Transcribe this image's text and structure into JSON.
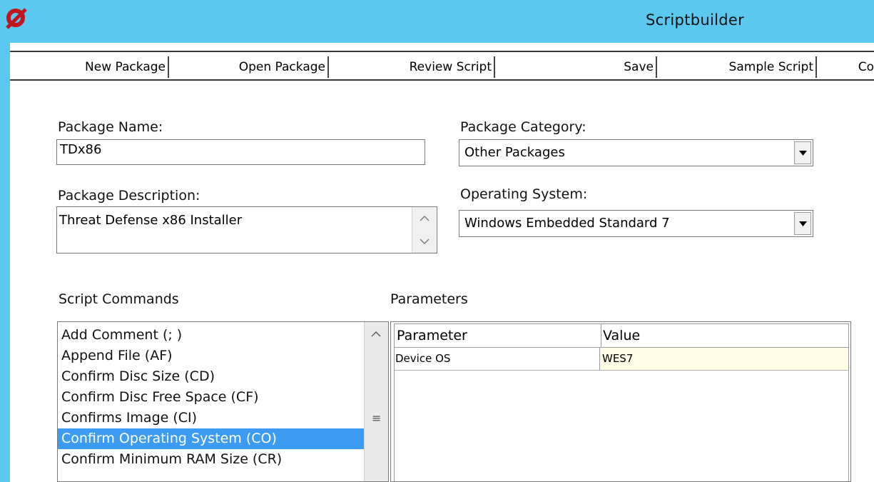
{
  "window": {
    "title": "Scriptbuilder",
    "accent_color": "#5bc8ef",
    "logo_icon": "app-logo-icon"
  },
  "toolbar": {
    "new_package": "New Package",
    "open_package": "Open Package",
    "review_script": "Review Script",
    "save": "Save",
    "sample_script": "Sample Script",
    "truncated": "Co"
  },
  "form": {
    "package_name_label": "Package Name:",
    "package_name_value": "TDx86",
    "package_description_label": "Package Description:",
    "package_description_value": "Threat Defense x86 Installer",
    "package_category_label": "Package Category:",
    "package_category_value": "Other Packages",
    "operating_system_label": "Operating System:",
    "operating_system_value": "Windows Embedded Standard 7"
  },
  "script_commands": {
    "label": "Script Commands",
    "selected_color": "#3d9bf1",
    "items": [
      {
        "label": "Add Comment (; )",
        "selected": false
      },
      {
        "label": "Append File (AF)",
        "selected": false
      },
      {
        "label": "Confirm Disc Size (CD)",
        "selected": false
      },
      {
        "label": "Confirm Disc Free Space (CF)",
        "selected": false
      },
      {
        "label": "Confirms Image (CI)",
        "selected": false
      },
      {
        "label": "Confirm Operating System (CO)",
        "selected": true
      },
      {
        "label": "Confirm Minimum RAM Size (CR)",
        "selected": false
      }
    ]
  },
  "parameters": {
    "label": "Parameters",
    "col_parameter": "Parameter",
    "col_value": "Value",
    "rows": [
      {
        "parameter": "Device OS",
        "value": "WES7"
      }
    ]
  }
}
